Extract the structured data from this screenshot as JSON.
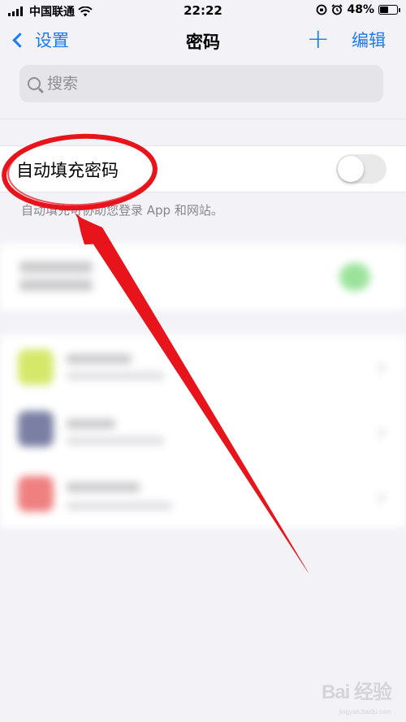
{
  "status_bar": {
    "carrier": "中国联通",
    "time": "22:22",
    "battery": "48%",
    "battery_level": 0.48
  },
  "nav": {
    "back_label": "设置",
    "title": "密码",
    "add_label": "+",
    "edit_label": "编辑"
  },
  "search": {
    "placeholder": "搜索"
  },
  "autofill": {
    "label": "自动填充密码",
    "enabled": false,
    "caption": "自动填充可协助您登录 App 和网站。"
  },
  "colors": {
    "accent": "#1a7cf5",
    "annotation": "#e8141b",
    "background": "#f2f2f7"
  },
  "watermark": {
    "text": "Bai 经验",
    "subtext": "jingyan.baidu.com"
  }
}
